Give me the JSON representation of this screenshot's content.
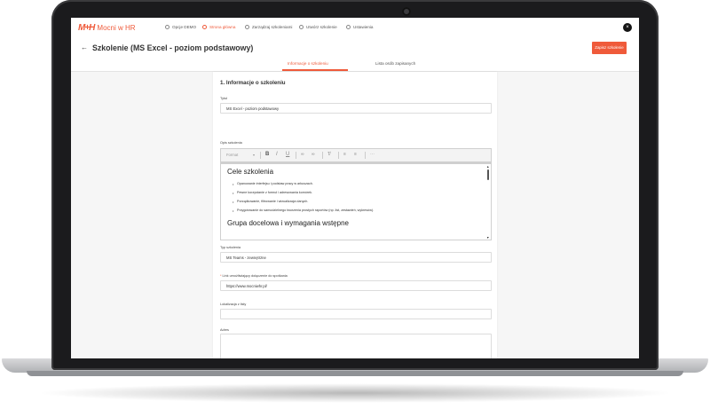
{
  "app": {
    "logo_mark": "M+H",
    "logo_text": "Mocni w HR"
  },
  "nav": {
    "items": [
      {
        "label": "Opcje DEMO",
        "icon": "settings-icon",
        "active": false
      },
      {
        "label": "Strona główna",
        "icon": "home-icon",
        "active": true
      },
      {
        "label": "Zarządzaj szkoleniami",
        "icon": "list-icon",
        "active": false
      },
      {
        "label": "Utwórz szkolenie",
        "icon": "plus-circle-icon",
        "active": false
      },
      {
        "label": "Ustawienia",
        "icon": "gear-icon",
        "active": false
      }
    ],
    "close_glyph": "×"
  },
  "header": {
    "back_glyph": "←",
    "title": "Szkolenie (MS Excel - poziom podstawowy)",
    "save_label": "Zapisz szkolenie"
  },
  "tabs": [
    {
      "label": "Informacje o szkoleniu",
      "active": true
    },
    {
      "label": "Lista osób zapisanych",
      "active": false
    }
  ],
  "form": {
    "section_title": "1. Informacje o szkoleniu",
    "title_label": "Tytuł",
    "title_value": "MS Excel - poziom podstawowy",
    "description_label": "Opis szkolenia",
    "editor": {
      "format_select": "Format",
      "content": {
        "heading1": "Cele szkolenia",
        "bullets": [
          "Opanowanie interfejsu i podstaw pracy w arkuszach.",
          "Pewne korzystanie z formuł i adresowania komórek.",
          "Porządkowanie, filtrowanie i wizualizacja danych.",
          "Przygotowanie do samodzielnego tworzenia prostych raportów (np. list, zestawień, wykresów)."
        ],
        "heading2": "Grupa docelowa i wymagania wstępne"
      }
    },
    "type_label": "Typ szkolenia",
    "type_value": "MS Teams - zewnętrzne",
    "link_required": "*",
    "link_label": "Link umożliwiający dołączenie do spotkania",
    "link_value": "https://www.mocniwhr.pl/",
    "location_label": "Lokalizacja z listy",
    "location_value": "",
    "address_label": "Adres",
    "address_value": ""
  },
  "colors": {
    "accent": "#ef5a3a",
    "bezel": "#1b1b1d"
  }
}
